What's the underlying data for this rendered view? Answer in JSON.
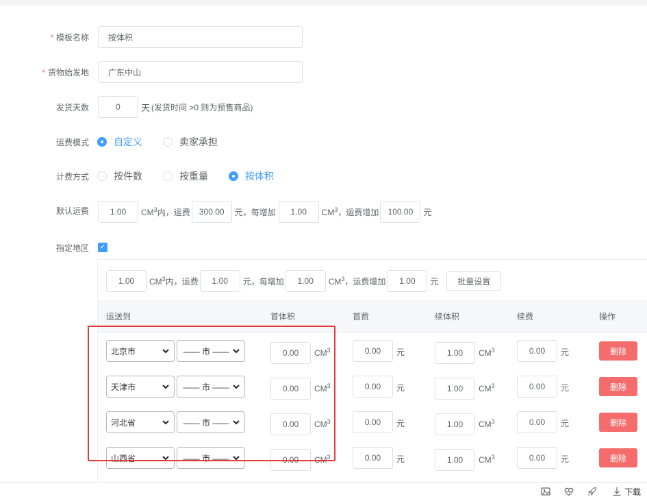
{
  "form": {
    "template_name": {
      "label": "模板名称",
      "required": "*",
      "value": "按体积"
    },
    "origin": {
      "label": "货物始发地",
      "required": "*",
      "value": "广东中山"
    },
    "ship_days": {
      "label": "发货天数",
      "value": "0",
      "suffix": "天",
      "hint": "(发货时间 >0 则为预售商品)"
    },
    "freight_mode": {
      "label": "运费模式",
      "options": [
        "自定义",
        "卖家承担"
      ],
      "selected": "自定义"
    },
    "billing_method": {
      "label": "计费方式",
      "options": [
        "按件数",
        "按重量",
        "按体积"
      ],
      "selected": "按体积"
    },
    "default_freight": {
      "label": "默认运费",
      "first_amount": "1.00",
      "unit_a": "CM",
      "sup": "3",
      "text_within": "内，运费",
      "first_fee": "300.00",
      "text_each": "元，每增加",
      "extra_amount": "1.00",
      "text_fee_inc": "，运费增加",
      "extra_fee": "100.00",
      "yuan": "元"
    },
    "designated_area": {
      "label": "指定地区",
      "checked": true
    }
  },
  "batch": {
    "first_amount": "1.00",
    "text_within": "内，运费",
    "first_fee": "1.00",
    "text_each": "元，每增加",
    "extra_amount": "1.00",
    "text_fee_inc": "，运费增加",
    "extra_fee": "1.00",
    "yuan": "元",
    "button": "批量设置"
  },
  "table": {
    "headers": [
      "运送到",
      "首体积",
      "首费",
      "续体积",
      "续费",
      "操作"
    ],
    "unit": "CM",
    "sup": "3",
    "yuan": "元",
    "city_placeholder": "—— 市 ——",
    "delete_label": "删除",
    "rows": [
      {
        "province": "北京市",
        "first_volume": "0.00",
        "first_fee": "0.00",
        "extra_volume": "1.00",
        "extra_fee": "0.00"
      },
      {
        "province": "天津市",
        "first_volume": "0.00",
        "first_fee": "0.00",
        "extra_volume": "1.00",
        "extra_fee": "0.00"
      },
      {
        "province": "河北省",
        "first_volume": "0.00",
        "first_fee": "0.00",
        "extra_volume": "1.00",
        "extra_fee": "0.00"
      },
      {
        "province": "山西省",
        "first_volume": "0.00",
        "first_fee": "0.00",
        "extra_volume": "1.00",
        "extra_fee": "0.00"
      }
    ]
  },
  "footer": {
    "icons": [
      "image-icon",
      "heart-pulse-icon",
      "rocket-icon",
      "download-icon"
    ],
    "download_label": "下载"
  },
  "colors": {
    "primary": "#409eff",
    "danger": "#f56c6c",
    "highlight_box": "#e53a3a"
  }
}
